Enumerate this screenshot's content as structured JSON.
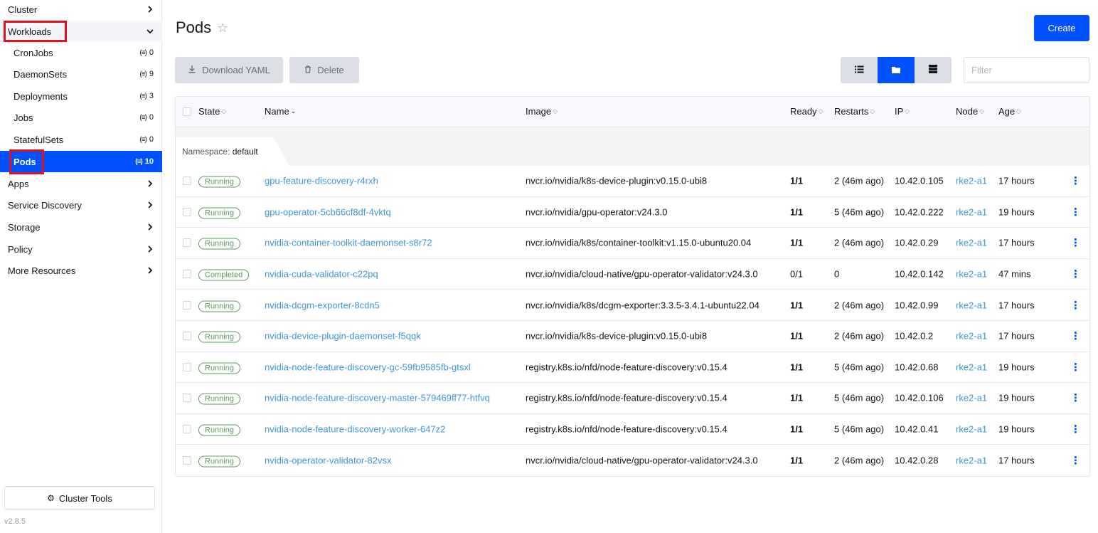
{
  "sidebar": {
    "items_top": [
      {
        "label": "Cluster"
      },
      {
        "label": "Workloads"
      }
    ],
    "workloads": [
      {
        "label": "CronJobs",
        "count": "0"
      },
      {
        "label": "DaemonSets",
        "count": "9"
      },
      {
        "label": "Deployments",
        "count": "3"
      },
      {
        "label": "Jobs",
        "count": "0"
      },
      {
        "label": "StatefulSets",
        "count": "0"
      },
      {
        "label": "Pods",
        "count": "10"
      }
    ],
    "items_bottom": [
      {
        "label": "Apps"
      },
      {
        "label": "Service Discovery"
      },
      {
        "label": "Storage"
      },
      {
        "label": "Policy"
      },
      {
        "label": "More Resources"
      }
    ],
    "cluster_tools": "Cluster Tools",
    "version": "v2.8.5"
  },
  "header": {
    "title": "Pods",
    "create": "Create",
    "download_yaml": "Download YAML",
    "delete": "Delete",
    "filter_placeholder": "Filter"
  },
  "table": {
    "columns": [
      "State",
      "Name",
      "Image",
      "Ready",
      "Restarts",
      "IP",
      "Node",
      "Age"
    ],
    "group_label": "Namespace:",
    "group_value": "default",
    "rows": [
      {
        "state": "Running",
        "name": "gpu-feature-discovery-r4rxh",
        "image": "nvcr.io/nvidia/k8s-device-plugin:v0.15.0-ubi8",
        "ready": "1/1",
        "restarts": "2 (46m ago)",
        "ip": "10.42.0.105",
        "node": "rke2-a1",
        "age": "17 hours"
      },
      {
        "state": "Running",
        "name": "gpu-operator-5cb66cf8df-4vktq",
        "image": "nvcr.io/nvidia/gpu-operator:v24.3.0",
        "ready": "1/1",
        "restarts": "5 (46m ago)",
        "ip": "10.42.0.222",
        "node": "rke2-a1",
        "age": "19 hours"
      },
      {
        "state": "Running",
        "name": "nvidia-container-toolkit-daemonset-s8r72",
        "image": "nvcr.io/nvidia/k8s/container-toolkit:v1.15.0-ubuntu20.04",
        "ready": "1/1",
        "restarts": "2 (46m ago)",
        "ip": "10.42.0.29",
        "node": "rke2-a1",
        "age": "17 hours"
      },
      {
        "state": "Completed",
        "name": "nvidia-cuda-validator-c22pq",
        "image": "nvcr.io/nvidia/cloud-native/gpu-operator-validator:v24.3.0",
        "ready": "0/1",
        "restarts": "0",
        "ip": "10.42.0.142",
        "node": "rke2-a1",
        "age": "47 mins"
      },
      {
        "state": "Running",
        "name": "nvidia-dcgm-exporter-8cdn5",
        "image": "nvcr.io/nvidia/k8s/dcgm-exporter:3.3.5-3.4.1-ubuntu22.04",
        "ready": "1/1",
        "restarts": "2 (46m ago)",
        "ip": "10.42.0.99",
        "node": "rke2-a1",
        "age": "17 hours"
      },
      {
        "state": "Running",
        "name": "nvidia-device-plugin-daemonset-f5qqk",
        "image": "nvcr.io/nvidia/k8s-device-plugin:v0.15.0-ubi8",
        "ready": "1/1",
        "restarts": "2 (46m ago)",
        "ip": "10.42.0.2",
        "node": "rke2-a1",
        "age": "17 hours"
      },
      {
        "state": "Running",
        "name": "nvidia-node-feature-discovery-gc-59fb9585fb-gtsxl",
        "image": "registry.k8s.io/nfd/node-feature-discovery:v0.15.4",
        "ready": "1/1",
        "restarts": "5 (46m ago)",
        "ip": "10.42.0.68",
        "node": "rke2-a1",
        "age": "19 hours"
      },
      {
        "state": "Running",
        "name": "nvidia-node-feature-discovery-master-579469ff77-htfvq",
        "image": "registry.k8s.io/nfd/node-feature-discovery:v0.15.4",
        "ready": "1/1",
        "restarts": "5 (46m ago)",
        "ip": "10.42.0.106",
        "node": "rke2-a1",
        "age": "19 hours"
      },
      {
        "state": "Running",
        "name": "nvidia-node-feature-discovery-worker-647z2",
        "image": "registry.k8s.io/nfd/node-feature-discovery:v0.15.4",
        "ready": "1/1",
        "restarts": "5 (46m ago)",
        "ip": "10.42.0.41",
        "node": "rke2-a1",
        "age": "19 hours"
      },
      {
        "state": "Running",
        "name": "nvidia-operator-validator-82vsx",
        "image": "nvcr.io/nvidia/cloud-native/gpu-operator-validator:v24.3.0",
        "ready": "1/1",
        "restarts": "2 (46m ago)",
        "ip": "10.42.0.28",
        "node": "rke2-a1",
        "age": "17 hours"
      }
    ]
  },
  "colors": {
    "accent": "#0052ff",
    "running": "#5d995d",
    "link": "#3d98d3",
    "highlight": "#e0101f"
  }
}
